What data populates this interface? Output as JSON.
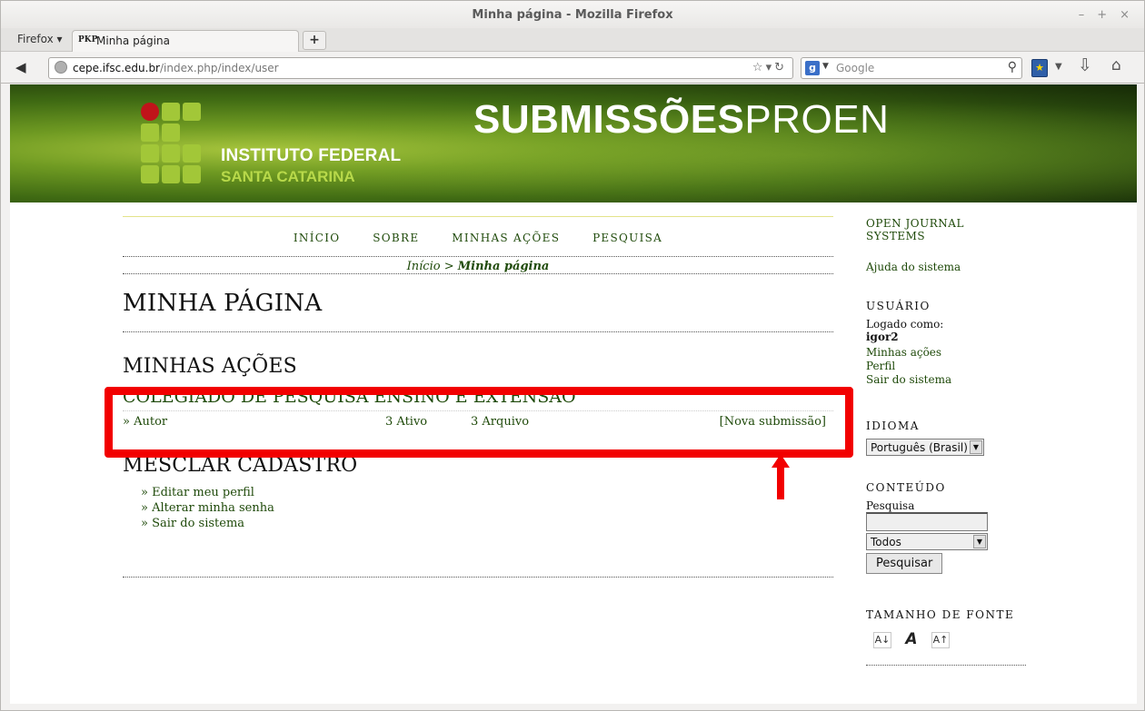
{
  "window": {
    "title": "Minha página - Mozilla Firefox",
    "controls": [
      "–",
      "+",
      "×"
    ]
  },
  "browser": {
    "menu": "Firefox ▾",
    "tab": {
      "favicon": "PKP",
      "title": "Minha página"
    },
    "new_tab": "+",
    "url_host": "cepe.ifsc.edu.br",
    "url_path": "/index.php/index/user",
    "url_prefix": "",
    "search_placeholder": "Google",
    "search_engine": "g"
  },
  "banner": {
    "institution_line1": "INSTITUTO FEDERAL",
    "institution_line2": "SANTA CATARINA",
    "brand_bold": "SUBMISSÕES",
    "brand_light": "PROEN"
  },
  "nav": {
    "items": [
      "INÍCIO",
      "SOBRE",
      "MINHAS AÇÕES",
      "PESQUISA"
    ]
  },
  "breadcrumb": {
    "home": "Início",
    "sep": ">",
    "current": "Minha página"
  },
  "page": {
    "title": "MINHA PÁGINA",
    "actions_heading": "MINHAS AÇÕES",
    "journal": {
      "name": "COLEGIADO DE PESQUISA ENSINO E EXTENSÃO",
      "role": "» Autor",
      "active": "3 Ativo",
      "archive": "3 Arquivo",
      "new_submission": "[Nova submissão]"
    },
    "merge_heading": "MESCLAR CADASTRO",
    "links": [
      "» Editar meu perfil",
      "» Alterar minha senha",
      "» Sair do sistema"
    ]
  },
  "sidebar": {
    "ojs": "OPEN JOURNAL SYSTEMS",
    "help": "Ajuda do sistema",
    "user_heading": "USUÁRIO",
    "logged_as": "Logado como:",
    "username": "igor2",
    "user_links": [
      "Minhas ações",
      "Perfil",
      "Sair do sistema"
    ],
    "language_heading": "IDIOMA",
    "language_value": "Português (Brasil)",
    "content_heading": "CONTEÚDO",
    "search_label": "Pesquisa",
    "search_scope": "Todos",
    "search_button": "Pesquisar",
    "font_heading": "TAMANHO DE FONTE",
    "font_icons": [
      "A↓",
      "A",
      "A↑"
    ]
  },
  "colors": {
    "link_green": "#1f4a0a",
    "highlight_red": "#f20000"
  }
}
